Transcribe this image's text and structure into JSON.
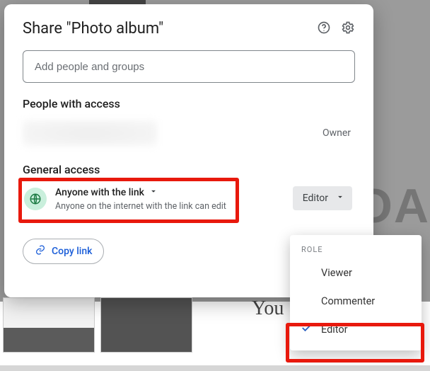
{
  "modal": {
    "title": "Share \"Photo album\"",
    "input_placeholder": "Add people and groups",
    "section_people": "People with access",
    "owner_label": "Owner",
    "section_general": "General access",
    "link_title": "Anyone with the link",
    "link_subtitle": "Anyone on the internet with the link can edit",
    "role_selected": "Editor",
    "copy_link": "Copy link"
  },
  "dropdown": {
    "label": "ROLE",
    "items": [
      {
        "label": "Viewer",
        "checked": false
      },
      {
        "label": "Commenter",
        "checked": false
      },
      {
        "label": "Editor",
        "checked": true
      }
    ]
  },
  "background": {
    "text_coa": "COA",
    "text_you": "You"
  }
}
